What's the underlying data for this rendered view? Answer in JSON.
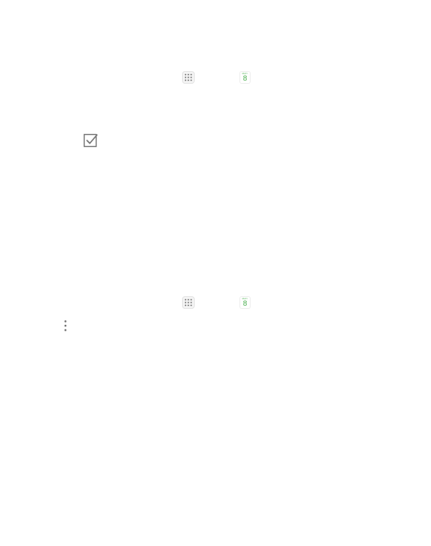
{
  "icons": {
    "apps": "apps-grid-icon",
    "calendar": "calendar-icon",
    "checkbox": "checkbox-icon",
    "more": "more-vert-icon"
  },
  "calendar": {
    "month": "MAY",
    "day": "8"
  },
  "colors": {
    "calendar_accent": "#4caf50",
    "icon_gray": "#757575",
    "background": "#ffffff"
  }
}
